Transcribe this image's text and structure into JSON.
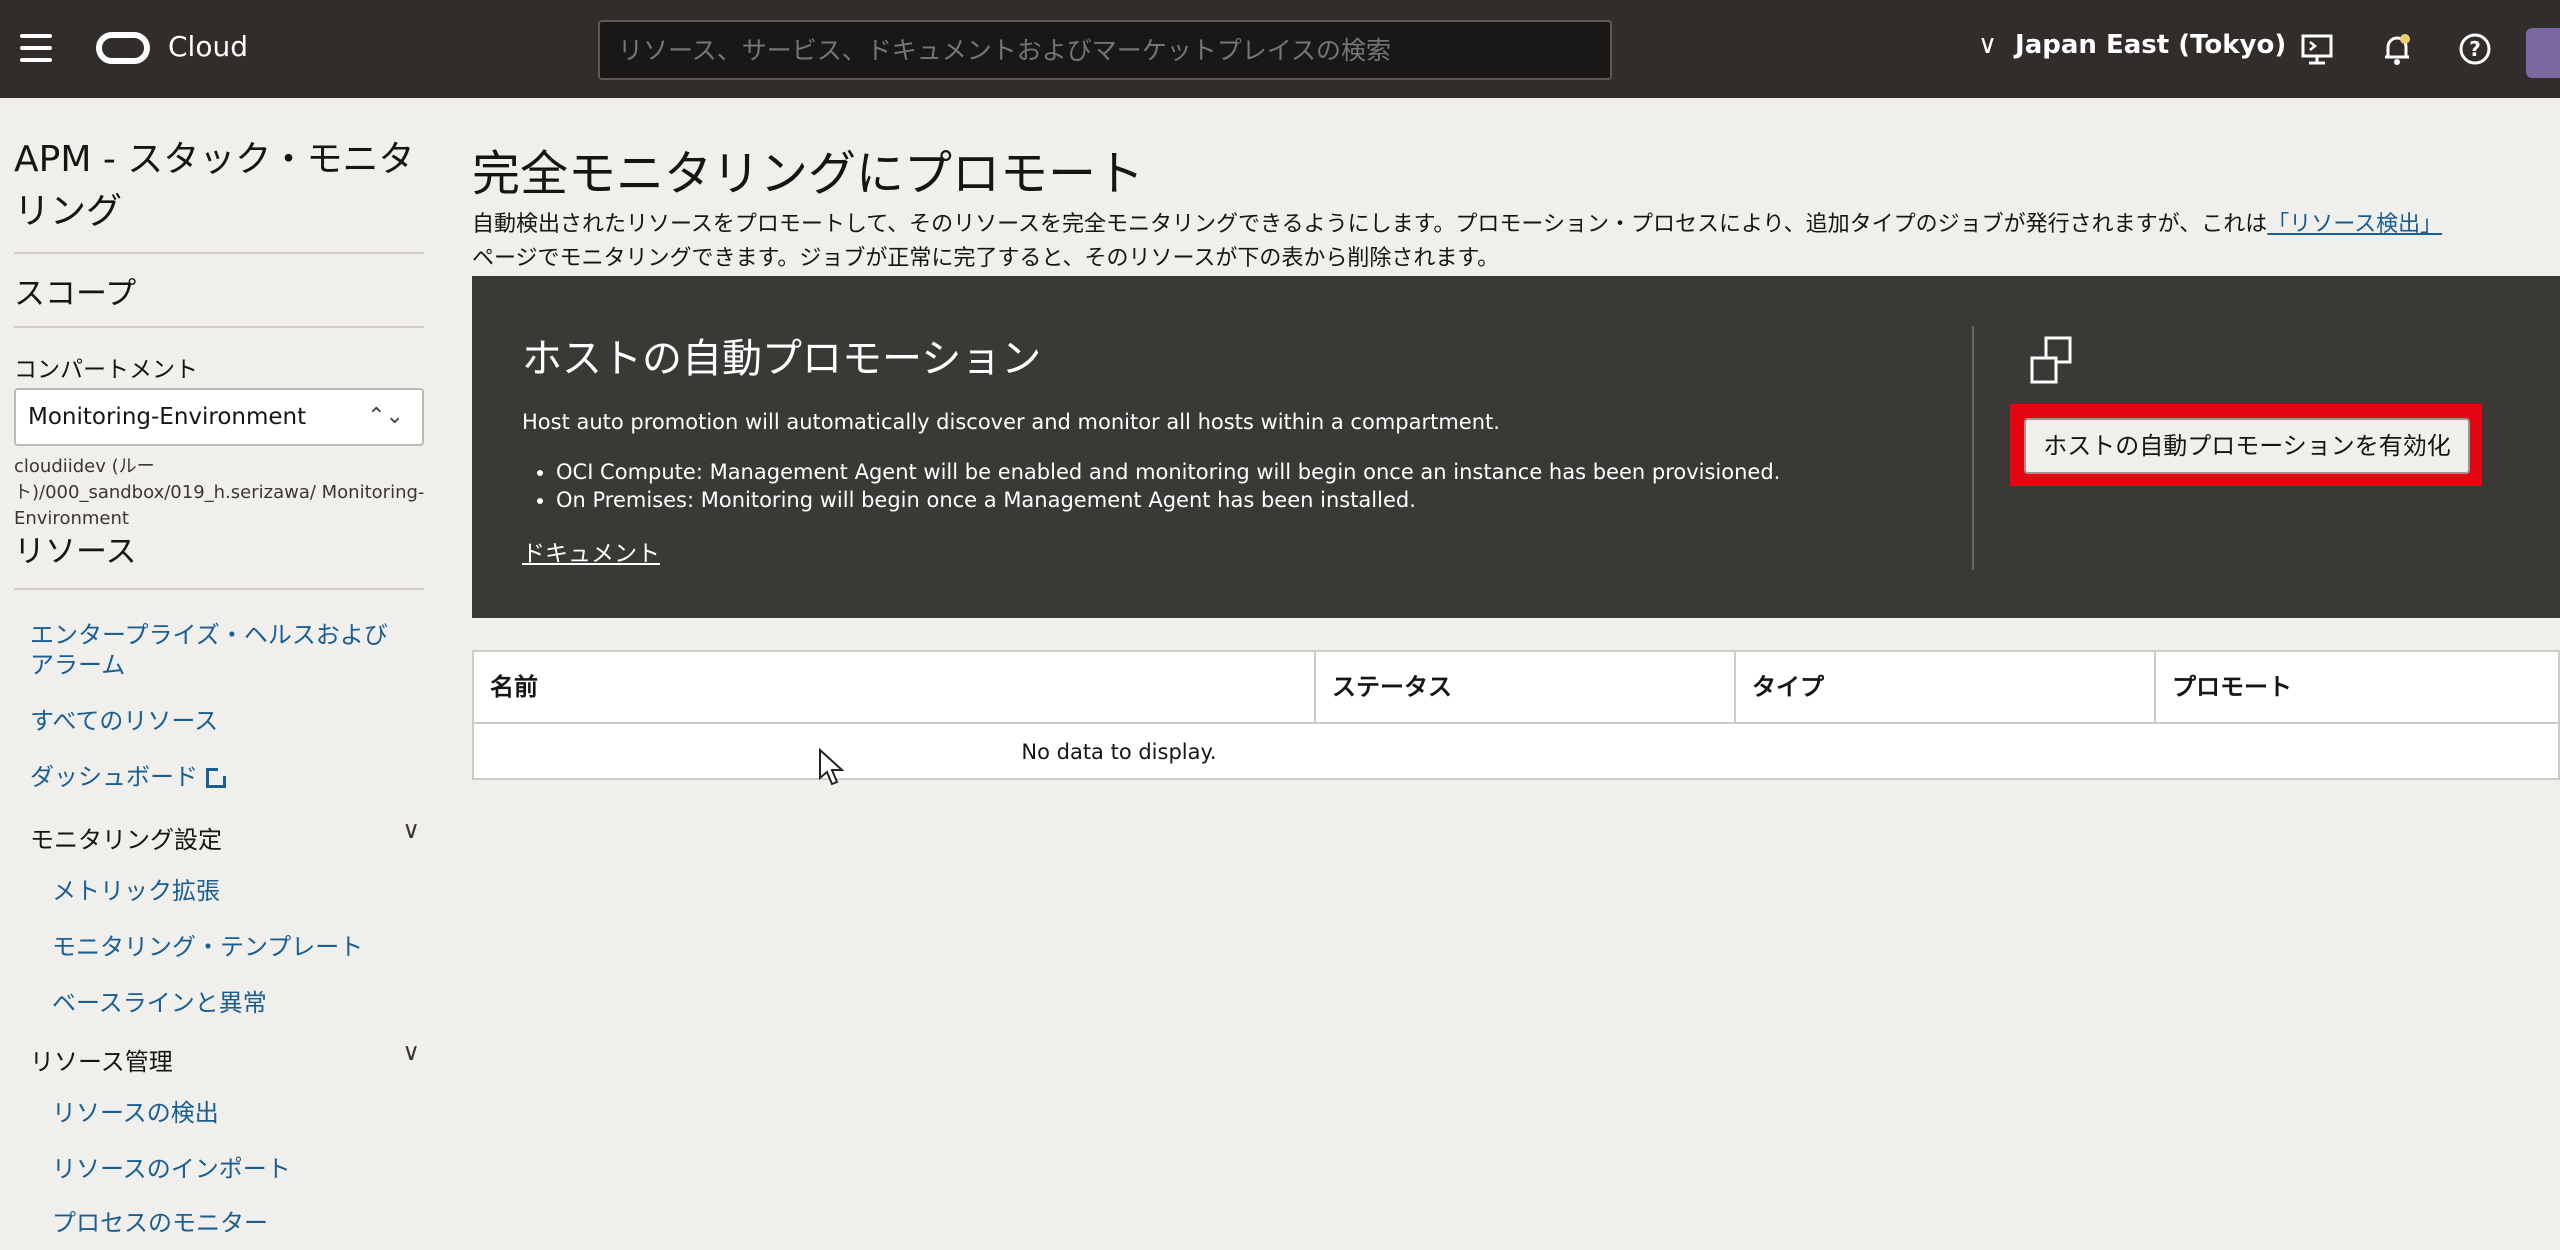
{
  "topbar": {
    "brand": "Cloud",
    "search_placeholder": "リソース、サービス、ドキュメントおよびマーケットプレイスの検索",
    "region": "Japan East (Tokyo)"
  },
  "sidebar": {
    "title": "APM - スタック・モニタリング",
    "scope": "スコープ",
    "compartment_label": "コンパートメント",
    "compartment_value": "Monitoring-Environment",
    "compartment_path": "cloudiidev (ルート)/000_sandbox/019_h.serizawa/ Monitoring-Environment",
    "resources": "リソース",
    "items": [
      {
        "label": "エンタープライズ・ヘルスおよびアラーム"
      },
      {
        "label": "すべてのリソース"
      },
      {
        "label": "ダッシュボード"
      },
      {
        "label": "モニタリング設定"
      },
      {
        "label": "メトリック拡張"
      },
      {
        "label": "モニタリング・テンプレート"
      },
      {
        "label": "ベースラインと異常"
      },
      {
        "label": "リソース管理"
      },
      {
        "label": "リソースの検出"
      },
      {
        "label": "リソースのインポート"
      },
      {
        "label": "プロセスのモニター"
      }
    ]
  },
  "main": {
    "title": "完全モニタリングにプロモート",
    "desc_part1": "自動検出されたリソースをプロモートして、そのリソースを完全モニタリングできるようにします。プロモーション・プロセスにより、追加タイプのジョブが発行されますが、これは",
    "desc_link": "「リソース検出」",
    "desc_part2": "ページでモニタリングできます。ジョブが正常に完了すると、そのリソースが下の表から削除されます。",
    "promo": {
      "title": "ホストの自動プロモーション",
      "text": "Host auto promotion will automatically discover and monitor all hosts within a compartment.",
      "bullets": [
        "OCI Compute: Management Agent will be enabled and monitoring will begin once an instance has been provisioned.",
        "On Premises: Monitoring will begin once a Management Agent has been installed."
      ],
      "doc_link": "ドキュメント",
      "button": "ホストの自動プロモーションを有効化"
    },
    "table": {
      "columns": [
        "名前",
        "ステータス",
        "タイプ",
        "プロモート"
      ],
      "empty": "No data to display."
    }
  },
  "colors": {
    "topbar": "#312d2a",
    "promo_bg": "#3b3936",
    "link": "#1a5f93",
    "highlight": "#e30613"
  }
}
